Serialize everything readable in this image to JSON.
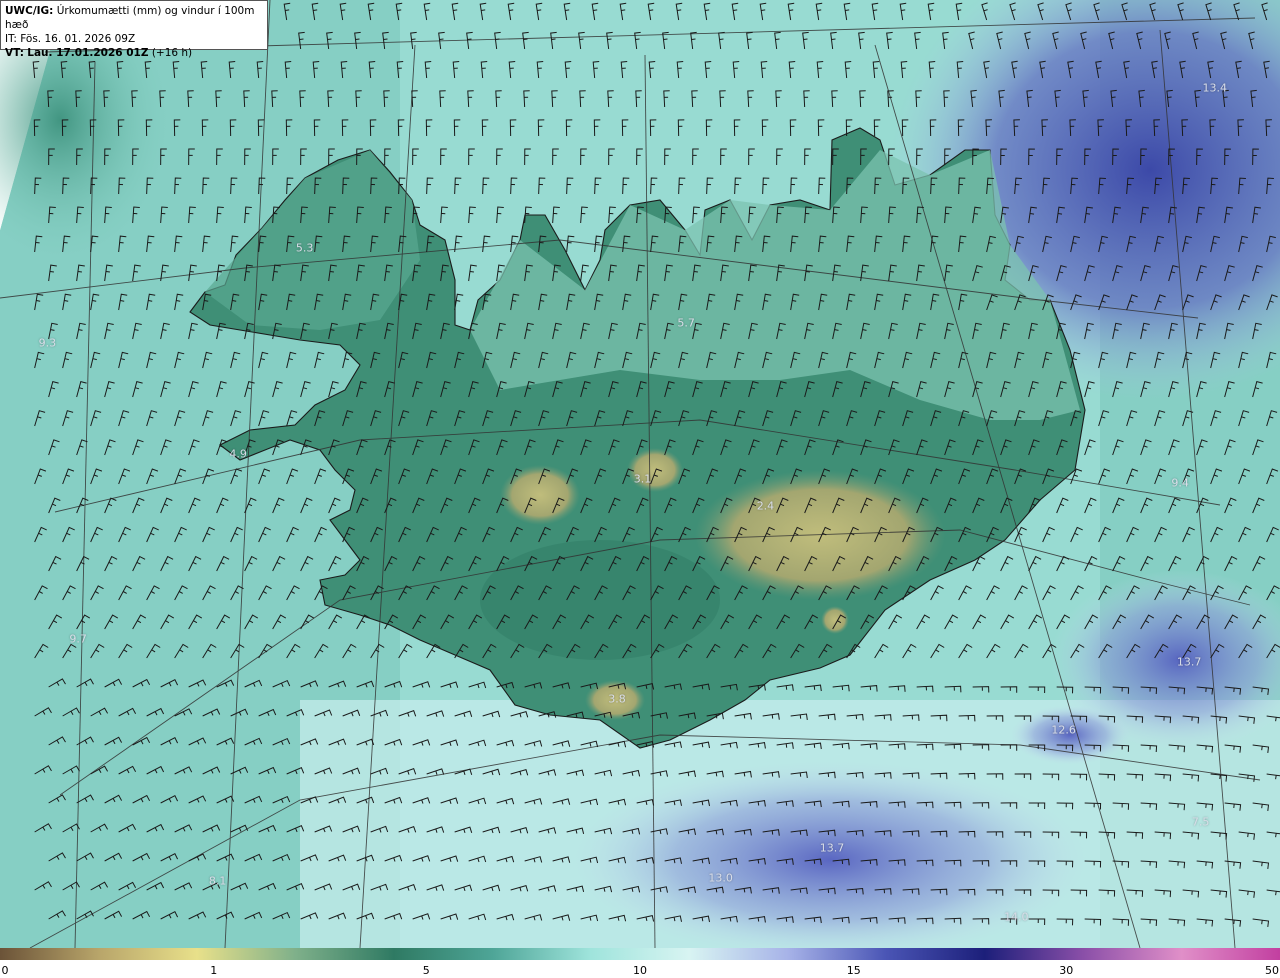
{
  "header": {
    "model": "UWC/IG:",
    "product": "Úrkomumætti (mm) og vindur í 100m hæð",
    "issue_time": "IT: Fös. 16. 01. 2026 09Z",
    "valid_prefix": "VT:",
    "valid_time": "Lau. 17.01.2026 01Z",
    "lead_time": "(+16 h)"
  },
  "value_labels": [
    {
      "text": "13.4",
      "fx": 0.949,
      "fy": 0.093
    },
    {
      "text": "5.3",
      "fx": 0.238,
      "fy": 0.262
    },
    {
      "text": "9.3",
      "fx": 0.037,
      "fy": 0.362
    },
    {
      "text": "5.7",
      "fx": 0.536,
      "fy": 0.341
    },
    {
      "text": "4.9",
      "fx": 0.186,
      "fy": 0.479
    },
    {
      "text": "3.1",
      "fx": 0.502,
      "fy": 0.505
    },
    {
      "text": "2.4",
      "fx": 0.598,
      "fy": 0.534
    },
    {
      "text": "9.4",
      "fx": 0.922,
      "fy": 0.509
    },
    {
      "text": "9.7",
      "fx": 0.061,
      "fy": 0.674
    },
    {
      "text": "13.7",
      "fx": 0.929,
      "fy": 0.698
    },
    {
      "text": "3.8",
      "fx": 0.482,
      "fy": 0.737
    },
    {
      "text": "12.6",
      "fx": 0.831,
      "fy": 0.77
    },
    {
      "text": "7.5",
      "fx": 0.938,
      "fy": 0.867
    },
    {
      "text": "13.7",
      "fx": 0.65,
      "fy": 0.894
    },
    {
      "text": "13.0",
      "fx": 0.563,
      "fy": 0.926
    },
    {
      "text": "8.1",
      "fx": 0.17,
      "fy": 0.929
    },
    {
      "text": "14.0",
      "fx": 0.794,
      "fy": 0.967
    }
  ],
  "colorbar": {
    "ticks": [
      {
        "label": "0",
        "pos": 0.0
      },
      {
        "label": "1",
        "pos": 0.167
      },
      {
        "label": "5",
        "pos": 0.333
      },
      {
        "label": "10",
        "pos": 0.5
      },
      {
        "label": "15",
        "pos": 0.667
      },
      {
        "label": "30",
        "pos": 0.833
      },
      {
        "label": "50",
        "pos": 1.0
      }
    ],
    "colors": [
      "#6b5338",
      "#b8a56a",
      "#e8e08a",
      "#7fb08a",
      "#2f7a63",
      "#4ea597",
      "#9fe4dc",
      "#d8f4f2",
      "#a7b3e8",
      "#4a55b5",
      "#1c1f7a",
      "#8a4fa8",
      "#e08fc8",
      "#c23fa0"
    ]
  },
  "colors": {
    "sea_teal": "#8fd6ce",
    "land_green": "#3e8c74",
    "glacier_yellow": "#b8b878",
    "blue_precip": "#4652b0"
  }
}
